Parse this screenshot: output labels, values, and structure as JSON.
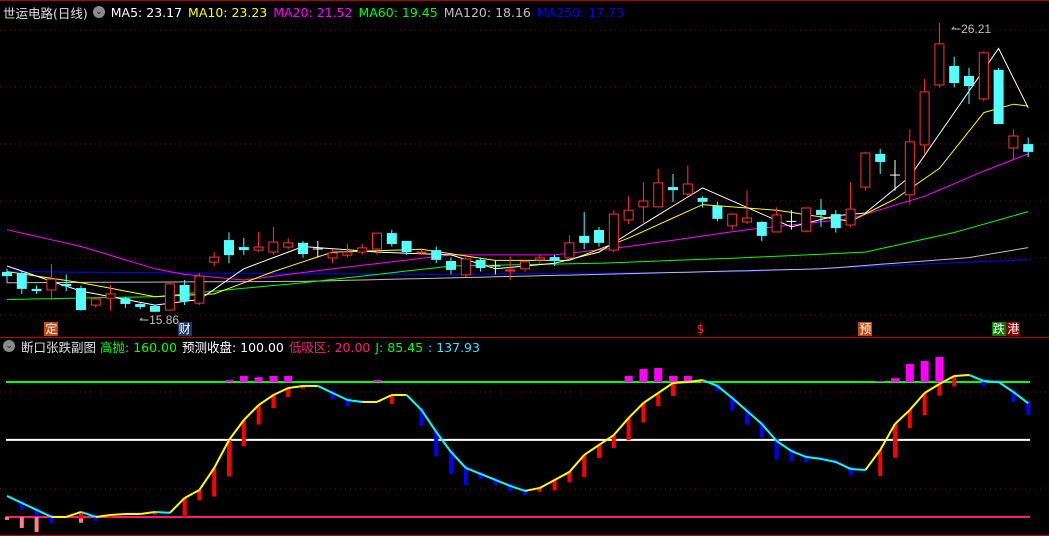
{
  "header": {
    "title": "世运电路(日线)",
    "ma_labels": [
      {
        "text": "MA5: 23.17",
        "color": "#ffffff"
      },
      {
        "text": "MA10: 23.23",
        "color": "#ffff00"
      },
      {
        "text": "MA20: 21.52",
        "color": "#ff00ff"
      },
      {
        "text": "MA60: 19.45",
        "color": "#00ff00"
      },
      {
        "text": "MA120: 18.16",
        "color": "#c0c0c0"
      },
      {
        "text": "MA250: 17.73",
        "color": "#0000ff"
      }
    ]
  },
  "sub_header": {
    "title": "断口张跌副图",
    "items": [
      {
        "text": "高抛: 160.00",
        "color": "#00ff00"
      },
      {
        "text": "预测收盘: 100.00",
        "color": "#ffffff"
      },
      {
        "text": "低吸区: 20.00",
        "color": "#ff1a7a"
      },
      {
        "text": "J: 85.45",
        "color": "#00ff00"
      },
      {
        "text": ": 137.93",
        "color": "#40e0ff"
      }
    ]
  },
  "annotations": {
    "high_label": "26.21",
    "low_label": "15.86",
    "markers": [
      {
        "text": "定",
        "index": 3,
        "bg": "#c04a10",
        "color": "#ffffff"
      },
      {
        "text": "财",
        "index": 12,
        "bg": "#1a3a6a",
        "color": "#ffffff"
      },
      {
        "text": "$",
        "index": 47,
        "bg": "transparent",
        "color": "#ff2020"
      },
      {
        "text": "预",
        "index": 58,
        "bg": "#c04a10",
        "color": "#ffffff"
      },
      {
        "text": "跌",
        "index": 67,
        "bg": "#008000",
        "color": "#ffffff"
      },
      {
        "text": "港",
        "index": 68,
        "bg": "#800000",
        "color": "#ffffff"
      }
    ]
  },
  "colors": {
    "up": "#ff3232",
    "down": "#54ffff",
    "grid": "#8b0000",
    "border": "#b00000"
  },
  "chart_data": {
    "type": "candlestick",
    "price_range": [
      15.86,
      26.21
    ],
    "candles": [
      [
        17.29,
        17.14,
        17.4,
        16.9
      ],
      [
        17.25,
        16.68,
        17.3,
        16.5
      ],
      [
        16.68,
        16.6,
        16.8,
        16.5
      ],
      [
        16.64,
        17.03,
        17.57,
        16.28
      ],
      [
        16.86,
        16.78,
        17.2,
        16.6
      ],
      [
        16.71,
        15.92,
        16.8,
        15.9
      ],
      [
        16.1,
        16.32,
        16.4,
        16.0
      ],
      [
        16.35,
        16.5,
        16.82,
        15.89
      ],
      [
        16.35,
        16.14,
        16.4,
        16.0
      ],
      [
        16.14,
        16.03,
        16.2,
        15.95
      ],
      [
        16.07,
        15.86,
        16.1,
        15.86
      ],
      [
        15.92,
        16.86,
        16.9,
        15.9
      ],
      [
        16.82,
        16.25,
        17.0,
        16.1
      ],
      [
        16.17,
        17.14,
        17.25,
        16.1
      ],
      [
        17.64,
        17.82,
        18.0,
        17.5
      ],
      [
        18.43,
        17.89,
        18.7,
        17.6
      ],
      [
        18.18,
        18.07,
        18.5,
        17.9
      ],
      [
        18.07,
        18.18,
        18.72,
        18.0
      ],
      [
        18.0,
        18.36,
        18.9,
        17.9
      ],
      [
        18.18,
        18.33,
        18.5,
        18.1
      ],
      [
        18.33,
        17.93,
        18.4,
        17.8
      ],
      [
        18.11,
        18.11,
        18.4,
        17.8
      ],
      [
        17.79,
        17.97,
        18.1,
        17.6
      ],
      [
        17.89,
        18.0,
        18.3,
        17.8
      ],
      [
        18.0,
        18.15,
        18.3,
        17.9
      ],
      [
        18.11,
        18.68,
        18.7,
        17.9
      ],
      [
        18.68,
        18.29,
        18.8,
        18.2
      ],
      [
        18.4,
        18.0,
        18.4,
        17.9
      ],
      [
        17.97,
        18.0,
        18.1,
        17.9
      ],
      [
        18.07,
        17.72,
        18.2,
        17.6
      ],
      [
        17.68,
        17.36,
        17.8,
        17.2
      ],
      [
        17.18,
        17.75,
        17.8,
        17.1
      ],
      [
        17.72,
        17.43,
        17.8,
        17.3
      ],
      [
        17.5,
        17.5,
        17.7,
        17.2
      ],
      [
        17.32,
        17.36,
        17.82,
        17.0
      ],
      [
        17.4,
        17.65,
        17.7,
        17.3
      ],
      [
        17.72,
        17.79,
        17.9,
        17.6
      ],
      [
        17.82,
        17.68,
        17.9,
        17.5
      ],
      [
        17.79,
        18.33,
        18.6,
        17.7
      ],
      [
        18.58,
        18.33,
        19.43,
        18.1
      ],
      [
        18.79,
        18.33,
        18.9,
        18.2
      ],
      [
        18.07,
        19.36,
        19.5,
        18.0
      ],
      [
        19.15,
        19.5,
        20.0,
        19.0
      ],
      [
        19.62,
        19.83,
        20.5,
        19.0
      ],
      [
        19.62,
        20.48,
        20.98,
        19.6
      ],
      [
        20.33,
        20.22,
        20.8,
        19.8
      ],
      [
        20.08,
        20.44,
        21.1,
        20.0
      ],
      [
        19.94,
        19.8,
        20.0,
        19.6
      ],
      [
        19.65,
        19.19,
        19.8,
        19.1
      ],
      [
        18.94,
        19.36,
        19.4,
        18.8
      ],
      [
        19.08,
        19.22,
        20.2,
        19.0
      ],
      [
        19.08,
        18.58,
        19.1,
        18.4
      ],
      [
        18.72,
        19.33,
        19.6,
        18.7
      ],
      [
        19.1,
        19.1,
        19.5,
        18.8
      ],
      [
        18.75,
        19.58,
        19.6,
        18.7
      ],
      [
        19.51,
        19.33,
        19.9,
        18.9
      ],
      [
        19.36,
        18.86,
        19.5,
        18.7
      ],
      [
        18.97,
        19.54,
        20.5,
        18.9
      ],
      [
        20.33,
        21.55,
        21.6,
        20.2
      ],
      [
        21.52,
        21.23,
        21.7,
        20.8
      ],
      [
        20.76,
        20.76,
        21.3,
        20.2
      ],
      [
        20.05,
        21.95,
        22.4,
        19.7
      ],
      [
        21.84,
        23.74,
        24.2,
        21.5
      ],
      [
        23.99,
        25.46,
        26.21,
        23.9
      ],
      [
        24.67,
        24.06,
        25.0,
        23.9
      ],
      [
        24.31,
        23.95,
        24.6,
        23.3
      ],
      [
        23.49,
        25.14,
        25.2,
        23.4
      ],
      [
        24.53,
        22.59,
        24.6,
        22.6
      ],
      [
        21.73,
        22.16,
        22.4,
        21.3
      ],
      [
        21.87,
        21.59,
        22.1,
        21.4
      ]
    ],
    "candle_fields": [
      "open",
      "close",
      "high",
      "low"
    ],
    "moving_averages": [
      {
        "name": "MA5",
        "color": "#ffffff",
        "points": [
          [
            0,
            17.5
          ],
          [
            5,
            16.6
          ],
          [
            10,
            16.1
          ],
          [
            13,
            16.3
          ],
          [
            16,
            17.4
          ],
          [
            20,
            18.2
          ],
          [
            25,
            18.0
          ],
          [
            30,
            17.9
          ],
          [
            33,
            17.4
          ],
          [
            37,
            17.6
          ],
          [
            40,
            18.0
          ],
          [
            43,
            19.0
          ],
          [
            47,
            20.3
          ],
          [
            50,
            19.6
          ],
          [
            53,
            18.9
          ],
          [
            56,
            19.3
          ],
          [
            58,
            19.4
          ],
          [
            61,
            20.7
          ],
          [
            64,
            23.0
          ],
          [
            67,
            25.3
          ],
          [
            69,
            23.17
          ]
        ]
      },
      {
        "name": "MA10",
        "color": "#ffff00",
        "points": [
          [
            0,
            17.3
          ],
          [
            5,
            16.9
          ],
          [
            10,
            16.4
          ],
          [
            14,
            16.5
          ],
          [
            18,
            17.3
          ],
          [
            22,
            18.0
          ],
          [
            28,
            18.1
          ],
          [
            33,
            17.7
          ],
          [
            38,
            17.7
          ],
          [
            42,
            18.5
          ],
          [
            47,
            19.7
          ],
          [
            52,
            19.5
          ],
          [
            57,
            19.1
          ],
          [
            60,
            19.9
          ],
          [
            63,
            21.0
          ],
          [
            66,
            23.0
          ],
          [
            68,
            23.3
          ],
          [
            69,
            23.23
          ]
        ]
      },
      {
        "name": "MA20",
        "color": "#ff00ff",
        "points": [
          [
            0,
            18.8
          ],
          [
            5,
            18.2
          ],
          [
            10,
            17.4
          ],
          [
            12,
            17.2
          ],
          [
            16,
            17.0
          ],
          [
            22,
            17.4
          ],
          [
            30,
            17.9
          ],
          [
            37,
            17.9
          ],
          [
            42,
            18.2
          ],
          [
            50,
            18.8
          ],
          [
            57,
            19.2
          ],
          [
            62,
            20.0
          ],
          [
            66,
            20.9
          ],
          [
            69,
            21.52
          ]
        ]
      },
      {
        "name": "MA60",
        "color": "#00ff00",
        "points": [
          [
            0,
            16.3
          ],
          [
            10,
            16.4
          ],
          [
            20,
            16.9
          ],
          [
            30,
            17.5
          ],
          [
            40,
            17.6
          ],
          [
            50,
            17.8
          ],
          [
            58,
            18.0
          ],
          [
            64,
            18.7
          ],
          [
            69,
            19.45
          ]
        ]
      },
      {
        "name": "MA120",
        "color": "#c0c0c0",
        "points": [
          [
            0,
            16.9
          ],
          [
            20,
            16.95
          ],
          [
            40,
            17.2
          ],
          [
            55,
            17.4
          ],
          [
            65,
            17.8
          ],
          [
            69,
            18.16
          ]
        ]
      },
      {
        "name": "MA250",
        "color": "#0000ff",
        "points": [
          [
            0,
            17.3
          ],
          [
            12,
            17.25
          ],
          [
            30,
            17.2
          ],
          [
            50,
            17.3
          ],
          [
            69,
            17.73
          ]
        ]
      }
    ],
    "indicator": {
      "name": "断口张跌副图",
      "range": [
        0,
        170
      ],
      "levels": [
        {
          "value": 160,
          "color": "#00ff00"
        },
        {
          "value": 100,
          "color": "#ffffff"
        },
        {
          "value": 20,
          "color": "#ff1a7a"
        }
      ],
      "line": [
        41.8,
        34.5,
        27.3,
        20,
        20,
        25.2,
        20,
        22.1,
        23.1,
        23.1,
        25.2,
        24.2,
        39.7,
        48,
        70.8,
        99.8,
        120.5,
        136.1,
        146.5,
        153.8,
        155.9,
        155.9,
        148.6,
        141.3,
        139.3,
        139.3,
        146.5,
        146.5,
        131,
        108.2,
        87.4,
        70.8,
        64.6,
        58.4,
        52.2,
        47,
        50.1,
        58.4,
        66.7,
        84.3,
        94.7,
        105,
        122.7,
        138.2,
        148.6,
        159,
        160,
        162,
        155.9,
        143.4,
        129.9,
        116.4,
        98.8,
        88.4,
        82.2,
        80.2,
        77,
        69.8,
        68.7,
        89.5,
        116.4,
        131,
        148.6,
        157.9,
        166.2,
        167.3,
        161,
        160,
        149.6,
        137.93
      ],
      "rise_color": "#ffff00",
      "fall_color": "#00ffff",
      "high_bars": [
        [
          15,
          162
        ],
        [
          16,
          166.2
        ],
        [
          17,
          165
        ],
        [
          18,
          166.2
        ],
        [
          19,
          166.2
        ],
        [
          25,
          162
        ],
        [
          42,
          166.2
        ],
        [
          43,
          173.5
        ],
        [
          44,
          174.5
        ],
        [
          45,
          166.2
        ],
        [
          46,
          166.2
        ],
        [
          59,
          161
        ],
        [
          60,
          164
        ],
        [
          61,
          178.7
        ],
        [
          62,
          181.8
        ],
        [
          63,
          185.9
        ]
      ],
      "low_bars": [
        [
          0,
          17
        ],
        [
          1,
          8.6
        ],
        [
          2,
          4.4
        ],
        [
          5,
          14
        ]
      ]
    }
  }
}
